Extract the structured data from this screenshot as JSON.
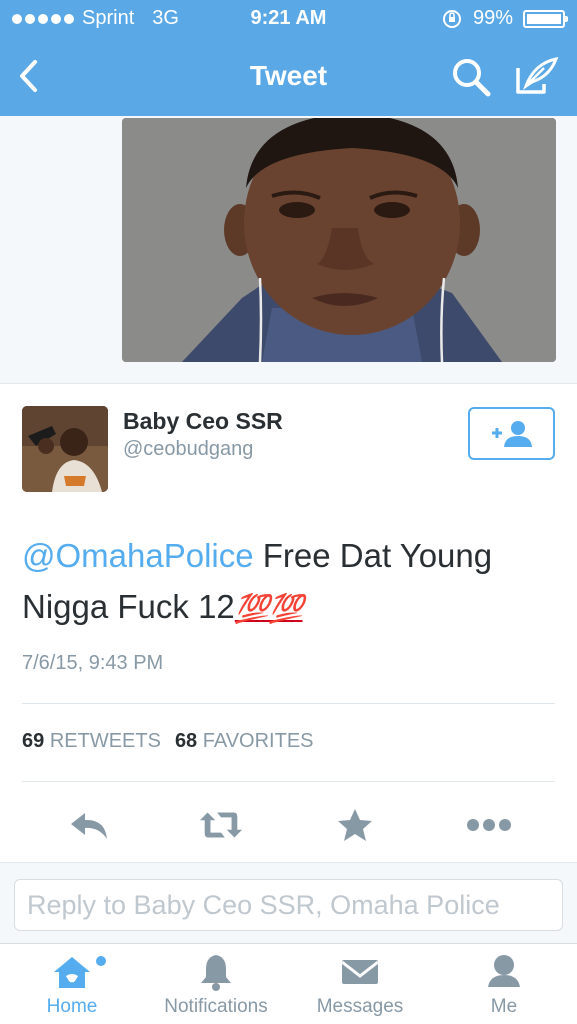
{
  "status_bar": {
    "carrier": "Sprint",
    "network": "3G",
    "time": "9:21 AM",
    "battery": "99%",
    "battery_level": 0.99
  },
  "nav": {
    "title": "Tweet",
    "back_icon": "chevron-left-icon",
    "search_icon": "search-icon",
    "compose_icon": "compose-icon"
  },
  "tweet": {
    "author_name": "Baby Ceo SSR",
    "author_handle": "@ceobudgang",
    "mention": "@OmahaPolice",
    "text": " Free Dat Young Nigga Fuck 12",
    "emoji": "💯💯",
    "date": "7/6/15, 9:43 PM"
  },
  "stats": {
    "retweets_count": "69",
    "retweets_label": "RETWEETS",
    "favorites_count": "68",
    "favorites_label": "FAVORITES"
  },
  "reply": {
    "placeholder": "Reply to Baby Ceo SSR, Omaha Police"
  },
  "tabs": [
    {
      "label": "Home",
      "icon": "home-icon"
    },
    {
      "label": "Notifications",
      "icon": "bell-icon"
    },
    {
      "label": "Messages",
      "icon": "envelope-icon"
    },
    {
      "label": "Me",
      "icon": "person-icon"
    }
  ],
  "colors": {
    "brand": "#5aa9e6",
    "accent": "#55acee",
    "muted": "#8899a6",
    "text": "#292f33"
  }
}
